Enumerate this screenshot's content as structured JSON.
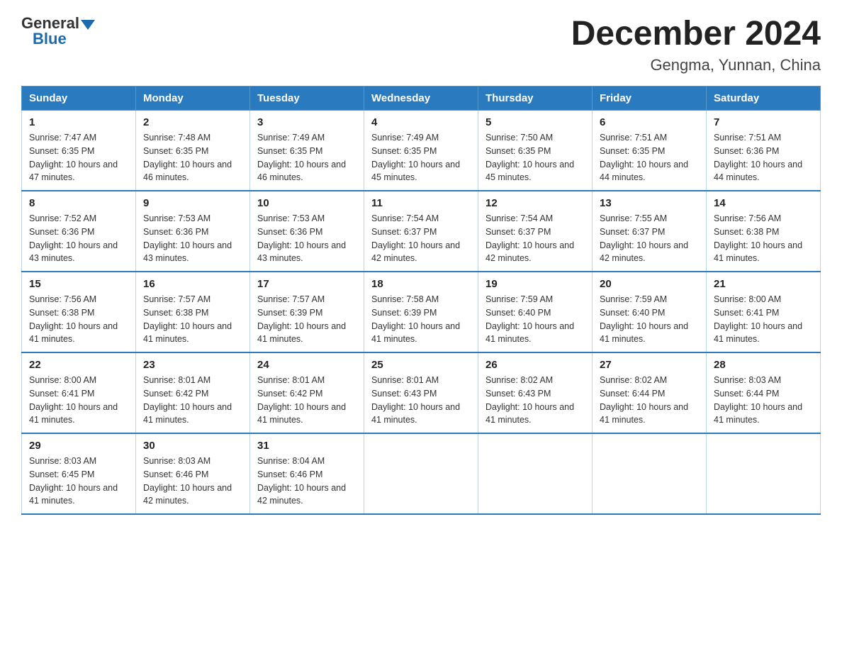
{
  "logo": {
    "general": "General",
    "blue": "Blue",
    "tagline": "Blue"
  },
  "title": "December 2024",
  "subtitle": "Gengma, Yunnan, China",
  "days_of_week": [
    "Sunday",
    "Monday",
    "Tuesday",
    "Wednesday",
    "Thursday",
    "Friday",
    "Saturday"
  ],
  "weeks": [
    [
      {
        "day": "1",
        "sunrise": "7:47 AM",
        "sunset": "6:35 PM",
        "daylight": "10 hours and 47 minutes."
      },
      {
        "day": "2",
        "sunrise": "7:48 AM",
        "sunset": "6:35 PM",
        "daylight": "10 hours and 46 minutes."
      },
      {
        "day": "3",
        "sunrise": "7:49 AM",
        "sunset": "6:35 PM",
        "daylight": "10 hours and 46 minutes."
      },
      {
        "day": "4",
        "sunrise": "7:49 AM",
        "sunset": "6:35 PM",
        "daylight": "10 hours and 45 minutes."
      },
      {
        "day": "5",
        "sunrise": "7:50 AM",
        "sunset": "6:35 PM",
        "daylight": "10 hours and 45 minutes."
      },
      {
        "day": "6",
        "sunrise": "7:51 AM",
        "sunset": "6:35 PM",
        "daylight": "10 hours and 44 minutes."
      },
      {
        "day": "7",
        "sunrise": "7:51 AM",
        "sunset": "6:36 PM",
        "daylight": "10 hours and 44 minutes."
      }
    ],
    [
      {
        "day": "8",
        "sunrise": "7:52 AM",
        "sunset": "6:36 PM",
        "daylight": "10 hours and 43 minutes."
      },
      {
        "day": "9",
        "sunrise": "7:53 AM",
        "sunset": "6:36 PM",
        "daylight": "10 hours and 43 minutes."
      },
      {
        "day": "10",
        "sunrise": "7:53 AM",
        "sunset": "6:36 PM",
        "daylight": "10 hours and 43 minutes."
      },
      {
        "day": "11",
        "sunrise": "7:54 AM",
        "sunset": "6:37 PM",
        "daylight": "10 hours and 42 minutes."
      },
      {
        "day": "12",
        "sunrise": "7:54 AM",
        "sunset": "6:37 PM",
        "daylight": "10 hours and 42 minutes."
      },
      {
        "day": "13",
        "sunrise": "7:55 AM",
        "sunset": "6:37 PM",
        "daylight": "10 hours and 42 minutes."
      },
      {
        "day": "14",
        "sunrise": "7:56 AM",
        "sunset": "6:38 PM",
        "daylight": "10 hours and 41 minutes."
      }
    ],
    [
      {
        "day": "15",
        "sunrise": "7:56 AM",
        "sunset": "6:38 PM",
        "daylight": "10 hours and 41 minutes."
      },
      {
        "day": "16",
        "sunrise": "7:57 AM",
        "sunset": "6:38 PM",
        "daylight": "10 hours and 41 minutes."
      },
      {
        "day": "17",
        "sunrise": "7:57 AM",
        "sunset": "6:39 PM",
        "daylight": "10 hours and 41 minutes."
      },
      {
        "day": "18",
        "sunrise": "7:58 AM",
        "sunset": "6:39 PM",
        "daylight": "10 hours and 41 minutes."
      },
      {
        "day": "19",
        "sunrise": "7:59 AM",
        "sunset": "6:40 PM",
        "daylight": "10 hours and 41 minutes."
      },
      {
        "day": "20",
        "sunrise": "7:59 AM",
        "sunset": "6:40 PM",
        "daylight": "10 hours and 41 minutes."
      },
      {
        "day": "21",
        "sunrise": "8:00 AM",
        "sunset": "6:41 PM",
        "daylight": "10 hours and 41 minutes."
      }
    ],
    [
      {
        "day": "22",
        "sunrise": "8:00 AM",
        "sunset": "6:41 PM",
        "daylight": "10 hours and 41 minutes."
      },
      {
        "day": "23",
        "sunrise": "8:01 AM",
        "sunset": "6:42 PM",
        "daylight": "10 hours and 41 minutes."
      },
      {
        "day": "24",
        "sunrise": "8:01 AM",
        "sunset": "6:42 PM",
        "daylight": "10 hours and 41 minutes."
      },
      {
        "day": "25",
        "sunrise": "8:01 AM",
        "sunset": "6:43 PM",
        "daylight": "10 hours and 41 minutes."
      },
      {
        "day": "26",
        "sunrise": "8:02 AM",
        "sunset": "6:43 PM",
        "daylight": "10 hours and 41 minutes."
      },
      {
        "day": "27",
        "sunrise": "8:02 AM",
        "sunset": "6:44 PM",
        "daylight": "10 hours and 41 minutes."
      },
      {
        "day": "28",
        "sunrise": "8:03 AM",
        "sunset": "6:44 PM",
        "daylight": "10 hours and 41 minutes."
      }
    ],
    [
      {
        "day": "29",
        "sunrise": "8:03 AM",
        "sunset": "6:45 PM",
        "daylight": "10 hours and 41 minutes."
      },
      {
        "day": "30",
        "sunrise": "8:03 AM",
        "sunset": "6:46 PM",
        "daylight": "10 hours and 42 minutes."
      },
      {
        "day": "31",
        "sunrise": "8:04 AM",
        "sunset": "6:46 PM",
        "daylight": "10 hours and 42 minutes."
      },
      null,
      null,
      null,
      null
    ]
  ],
  "labels": {
    "sunrise": "Sunrise:",
    "sunset": "Sunset:",
    "daylight": "Daylight:"
  }
}
